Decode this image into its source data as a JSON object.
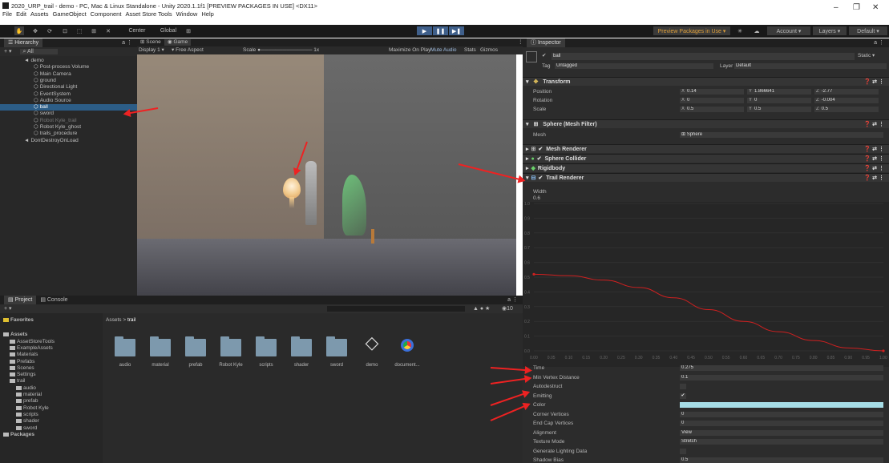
{
  "window": {
    "title": "2020_URP_trail - demo - PC, Mac & Linux Standalone - Unity 2020.1.1f1 [PREVIEW PACKAGES IN USE] <DX11>",
    "menu": [
      "File",
      "Edit",
      "Assets",
      "GameObject",
      "Component",
      "Asset Store Tools",
      "Window",
      "Help"
    ],
    "controls": {
      "minimize": "–",
      "maximize": "❐",
      "close": "✕"
    }
  },
  "toolbar": {
    "pivot": "Center",
    "space": "Global",
    "preview_packages": "Preview Packages in Use ▾",
    "account": "Account ▾",
    "layers": "Layers ▾",
    "layout": "Default ▾"
  },
  "hierarchy": {
    "title": "Hierarchy",
    "search": "All",
    "items": [
      {
        "label": "demo",
        "depth": 0,
        "expanded": true
      },
      {
        "label": "Post-process Volume",
        "depth": 1
      },
      {
        "label": "Main Camera",
        "depth": 1
      },
      {
        "label": "ground",
        "depth": 1
      },
      {
        "label": "Directional Light",
        "depth": 1
      },
      {
        "label": "EventSystem",
        "depth": 1
      },
      {
        "label": "Audio Source",
        "depth": 1
      },
      {
        "label": "ball",
        "depth": 1,
        "selected": true
      },
      {
        "label": "sword",
        "depth": 1
      },
      {
        "label": "Robot Kyle_trail",
        "depth": 1,
        "dim": true
      },
      {
        "label": "Robot Kyle_ghost",
        "depth": 1
      },
      {
        "label": "trails_procedure",
        "depth": 1
      },
      {
        "label": "DontDestroyOnLoad",
        "depth": 0
      }
    ]
  },
  "scene_view": {
    "tabs": [
      "Scene",
      "Game"
    ],
    "display": "Display 1",
    "aspect": "Free Aspect",
    "scale_label": "Scale",
    "scale_value": "1x",
    "options": [
      "Maximize On Play",
      "Mute Audio",
      "Stats",
      "Gizmos"
    ]
  },
  "project": {
    "tabs": [
      "Project",
      "Console"
    ],
    "count": "10",
    "breadcrumb_root": "Assets",
    "breadcrumb_sep": ">",
    "breadcrumb_leaf": "trail",
    "tree": [
      {
        "label": "Favorites",
        "depth": 0,
        "star": true
      },
      {
        "label": "Assets",
        "depth": 0
      },
      {
        "label": "AssetStoreTools",
        "depth": 1
      },
      {
        "label": "ExampleAssets",
        "depth": 1
      },
      {
        "label": "Materials",
        "depth": 1
      },
      {
        "label": "Prefabs",
        "depth": 1
      },
      {
        "label": "Scenes",
        "depth": 1
      },
      {
        "label": "Settings",
        "depth": 1
      },
      {
        "label": "trail",
        "depth": 1
      },
      {
        "label": "audio",
        "depth": 2
      },
      {
        "label": "material",
        "depth": 2
      },
      {
        "label": "prefab",
        "depth": 2
      },
      {
        "label": "Robot Kyle",
        "depth": 2
      },
      {
        "label": "scripts",
        "depth": 2
      },
      {
        "label": "shader",
        "depth": 2
      },
      {
        "label": "sword",
        "depth": 2
      },
      {
        "label": "Packages",
        "depth": 0
      }
    ],
    "files": [
      {
        "label": "audio",
        "type": "folder"
      },
      {
        "label": "material",
        "type": "folder"
      },
      {
        "label": "prefab",
        "type": "folder"
      },
      {
        "label": "Robot Kyle",
        "type": "folder"
      },
      {
        "label": "scripts",
        "type": "folder"
      },
      {
        "label": "shader",
        "type": "folder"
      },
      {
        "label": "sword",
        "type": "folder"
      },
      {
        "label": "demo",
        "type": "unity"
      },
      {
        "label": "document...",
        "type": "chrome"
      }
    ]
  },
  "inspector": {
    "title": "Inspector",
    "object_name": "ball",
    "static": "Static ▾",
    "tag_label": "Tag",
    "tag": "Untagged",
    "layer_label": "Layer",
    "layer": "Default",
    "transform": {
      "title": "Transform",
      "position_label": "Position",
      "rotation_label": "Rotation",
      "scale_label": "Scale",
      "position": [
        "0.14",
        "1.866641",
        "-2.77"
      ],
      "rotation": [
        "0",
        "0",
        "-0.004"
      ],
      "scale": [
        "0.5",
        "0.5",
        "0.5"
      ]
    },
    "mesh_filter": {
      "title": "Sphere (Mesh Filter)",
      "mesh_label": "Mesh",
      "mesh": "Sphere"
    },
    "components": [
      "Mesh Renderer",
      "Sphere Collider",
      "Rigidbody",
      "Trail Renderer"
    ],
    "trail": {
      "width_label": "Width",
      "width_value": "0.6",
      "y_ticks": [
        "1.0",
        "0.9",
        "0.8",
        "0.7",
        "0.6",
        "0.5",
        "0.4",
        "0.3",
        "0.2",
        "0.1",
        "0.0"
      ],
      "x_ticks": [
        "0.00",
        "0.05",
        "0.10",
        "0.15",
        "0.20",
        "0.25",
        "0.30",
        "0.35",
        "0.40",
        "0.45",
        "0.50",
        "0.55",
        "0.60",
        "0.65",
        "0.70",
        "0.75",
        "0.80",
        "0.85",
        "0.90",
        "0.95",
        "1.00"
      ],
      "curve": [
        [
          0,
          0.52
        ],
        [
          0.1,
          0.51
        ],
        [
          0.2,
          0.48
        ],
        [
          0.3,
          0.43
        ],
        [
          0.4,
          0.36
        ],
        [
          0.5,
          0.28
        ],
        [
          0.6,
          0.2
        ],
        [
          0.7,
          0.13
        ],
        [
          0.8,
          0.07
        ],
        [
          0.9,
          0.02
        ],
        [
          1,
          0
        ]
      ],
      "props": [
        {
          "label": "Time",
          "value": "0.275"
        },
        {
          "label": "Min Vertex Distance",
          "value": "0.1"
        },
        {
          "label": "Autodestruct",
          "value": ""
        },
        {
          "label": "Emitting",
          "value": "✔"
        },
        {
          "label": "Color",
          "value": ""
        },
        {
          "label": "Corner Vertices",
          "value": "0"
        },
        {
          "label": "End Cap Vertices",
          "value": "0"
        },
        {
          "label": "Alignment",
          "value": "View"
        },
        {
          "label": "Texture Mode",
          "value": "Stretch"
        },
        {
          "label": "Generate Lighting Data",
          "value": ""
        },
        {
          "label": "Shadow Bias",
          "value": "0.5"
        }
      ]
    }
  },
  "colors": {
    "accent": "#e8271d",
    "selection": "#2c5d87",
    "trail_color": "#a6dde6",
    "curve": "#d02020"
  }
}
